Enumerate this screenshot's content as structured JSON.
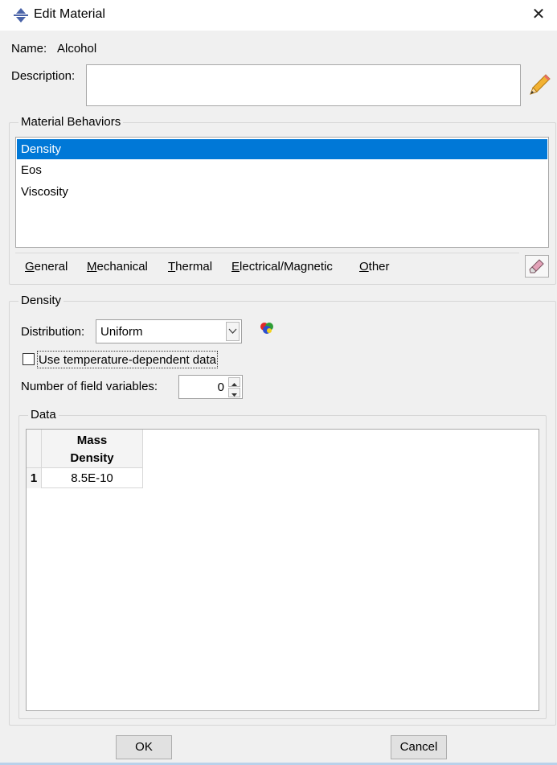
{
  "window": {
    "title": "Edit Material",
    "title_icon": "abaqus-diamond-icon",
    "close_glyph": "✕"
  },
  "name": {
    "label": "Name:",
    "value": "Alcohol"
  },
  "description": {
    "label": "Description:",
    "value": "",
    "edit_icon": "pencil-icon"
  },
  "behaviors": {
    "title": "Material Behaviors",
    "items": [
      {
        "label": "Density",
        "selected": true
      },
      {
        "label": "Eos",
        "selected": false
      },
      {
        "label": "Viscosity",
        "selected": false
      }
    ],
    "menu": [
      {
        "mnemonic": "G",
        "rest": "eneral"
      },
      {
        "mnemonic": "M",
        "rest": "echanical"
      },
      {
        "mnemonic": "T",
        "rest": "hermal"
      },
      {
        "mnemonic": "E",
        "rest": "lectrical/Magnetic"
      },
      {
        "mnemonic": "O",
        "rest": "ther"
      }
    ],
    "delete_icon": "eraser-icon"
  },
  "density": {
    "title": "Density",
    "distribution_label": "Distribution:",
    "distribution_value": "Uniform",
    "distribution_icon": "color-ball-icon",
    "temp_dependent_label": "Use temperature-dependent data",
    "temp_dependent_checked": false,
    "field_vars_label": "Number of field variables:",
    "field_vars_value": "0",
    "data": {
      "title": "Data",
      "columns": [
        {
          "line1": "Mass",
          "line2": "Density"
        }
      ],
      "rows": [
        {
          "index": "1",
          "values": [
            "8.5E-10"
          ]
        }
      ]
    }
  },
  "buttons": {
    "ok": "OK",
    "cancel": "Cancel"
  },
  "colors": {
    "selection": "#0078d7",
    "background": "#f0f0f0"
  }
}
